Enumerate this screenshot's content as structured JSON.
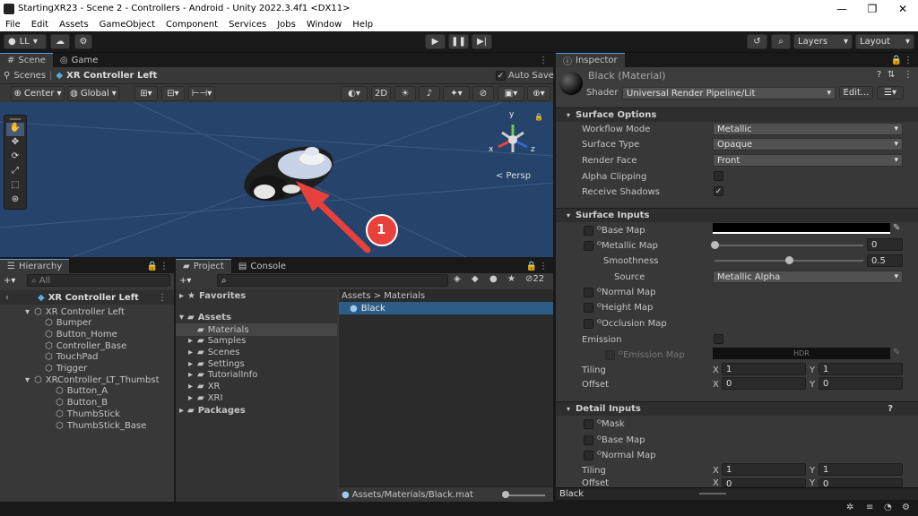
{
  "window": {
    "title": "StartingXR23 - Scene 2 - Controllers - Android - Unity 2022.3.4f1 <DX11>",
    "controls": [
      "—",
      "❐",
      "✕"
    ]
  },
  "menu": [
    "File",
    "Edit",
    "Assets",
    "GameObject",
    "Component",
    "Services",
    "Jobs",
    "Window",
    "Help"
  ],
  "toolbar": {
    "account": "LL",
    "layers": "Layers",
    "layout": "Layout"
  },
  "scene_tabs": {
    "scene": "Scene",
    "game": "Game"
  },
  "breadcrumb": {
    "scenes": "Scenes",
    "object": "XR Controller Left",
    "auto_save": "Auto Save"
  },
  "scene_toolbar": {
    "pivot": "Center",
    "space": "Global",
    "mode2d": "2D"
  },
  "viewport": {
    "persp": "< Persp",
    "gizmo_y": "y",
    "gizmo_x": "x",
    "gizmo_z": "z",
    "annotation_number": "1"
  },
  "hierarchy": {
    "tab": "Hierarchy",
    "search_placeholder": "All",
    "root": "XR Controller Left",
    "items": [
      {
        "label": "XR Controller Left",
        "indent": 1
      },
      {
        "label": "Bumper",
        "indent": 2
      },
      {
        "label": "Button_Home",
        "indent": 2
      },
      {
        "label": "Controller_Base",
        "indent": 2
      },
      {
        "label": "TouchPad",
        "indent": 2
      },
      {
        "label": "Trigger",
        "indent": 2
      },
      {
        "label": "XRController_LT_Thumbst",
        "indent": 1
      },
      {
        "label": "Button_A",
        "indent": 3
      },
      {
        "label": "Button_B",
        "indent": 3
      },
      {
        "label": "ThumbStick",
        "indent": 3
      },
      {
        "label": "ThumbStick_Base",
        "indent": 3
      }
    ]
  },
  "project": {
    "tab": "Project",
    "console_tab": "Console",
    "hidden_count": "22",
    "breadcrumb": "Assets > Materials",
    "favorites": "Favorites",
    "assets": "Assets",
    "folders": [
      "Materials",
      "Samples",
      "Scenes",
      "Settings",
      "TutorialInfo",
      "XR",
      "XRI"
    ],
    "packages": "Packages",
    "asset_item": "Black",
    "footer_path": "Assets/Materials/Black.mat"
  },
  "inspector": {
    "tab": "Inspector",
    "material_name": "Black (Material)",
    "shader_label": "Shader",
    "shader_value": "Universal Render Pipeline/Lit",
    "edit_btn": "Edit...",
    "surface_options": {
      "title": "Surface Options",
      "workflow_label": "Workflow Mode",
      "workflow_value": "Metallic",
      "surface_label": "Surface Type",
      "surface_value": "Opaque",
      "render_face_label": "Render Face",
      "render_face_value": "Front",
      "alpha_label": "Alpha Clipping",
      "shadows_label": "Receive Shadows"
    },
    "surface_inputs": {
      "title": "Surface Inputs",
      "base_map": "Base Map",
      "metallic_map": "Metallic Map",
      "metallic_value": "0",
      "metallic_slider": 0.0,
      "smoothness": "Smoothness",
      "smoothness_value": "0.5",
      "smoothness_slider": 0.5,
      "source_label": "Source",
      "source_value": "Metallic Alpha",
      "normal_map": "Normal Map",
      "height_map": "Height Map",
      "occlusion_map": "Occlusion Map",
      "emission": "Emission",
      "emission_map": "Emission Map",
      "hdr": "HDR",
      "tiling": "Tiling",
      "offset": "Offset",
      "tx": "1",
      "ty": "1",
      "ox": "0",
      "oy": "0",
      "x": "X",
      "y": "Y"
    },
    "detail_inputs": {
      "title": "Detail Inputs",
      "mask": "Mask",
      "base_map": "Base Map",
      "normal_map": "Normal Map",
      "tiling": "Tiling",
      "offset": "Offset",
      "tx": "1",
      "ty": "1",
      "ox": "0",
      "oy": "0"
    },
    "footer": "Black"
  },
  "colors": {
    "viewport": "#26436b",
    "accent": "#2c5d87",
    "arrow": "#e8413c"
  }
}
